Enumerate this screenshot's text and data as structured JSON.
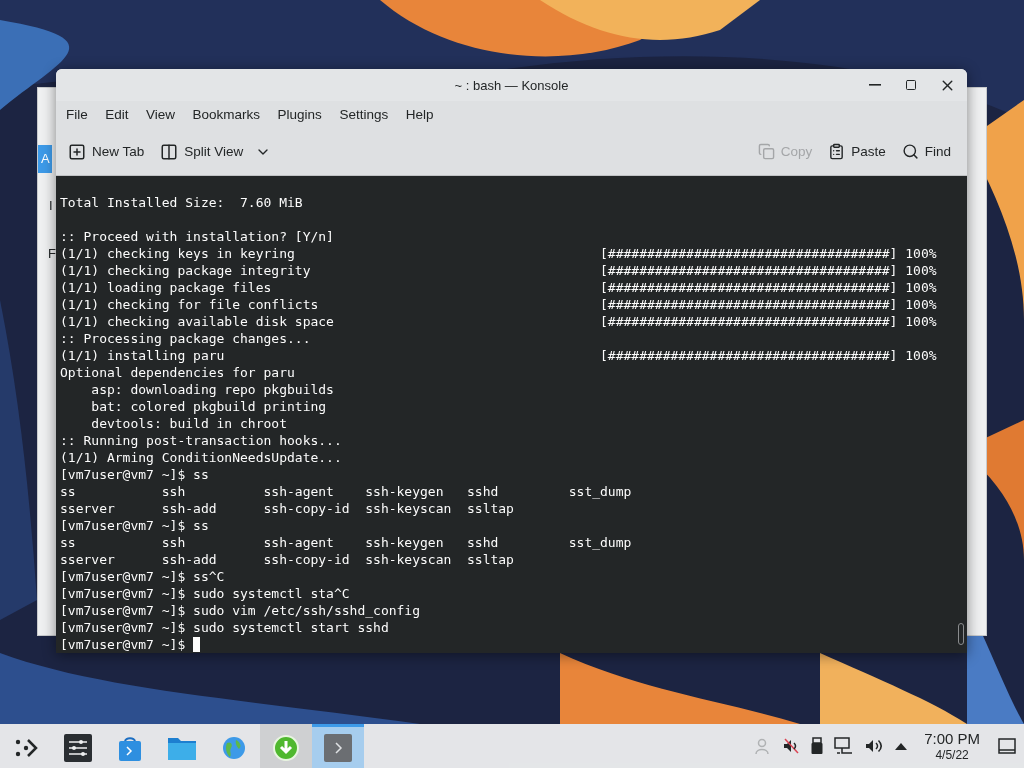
{
  "background_window": {
    "fragments": [
      "A",
      "I",
      "F"
    ]
  },
  "window": {
    "title": "~ : bash — Konsole"
  },
  "menu": [
    "File",
    "Edit",
    "View",
    "Bookmarks",
    "Plugins",
    "Settings",
    "Help"
  ],
  "toolbar": {
    "left": [
      {
        "label": "New Tab",
        "kind": "new-tab"
      },
      {
        "label": "Split View",
        "kind": "split-view"
      }
    ],
    "right": [
      {
        "label": "Copy",
        "kind": "copy",
        "disabled": true
      },
      {
        "label": "Paste",
        "kind": "paste",
        "disabled": false
      },
      {
        "label": "Find",
        "kind": "find",
        "disabled": false
      }
    ]
  },
  "terminal": {
    "lines": [
      {
        "kind": "text",
        "text": "Total Installed Size:  7.60 MiB"
      },
      {
        "kind": "blank"
      },
      {
        "kind": "text",
        "text": ":: Proceed with installation? [Y/n]"
      },
      {
        "kind": "progress",
        "text": "(1/1) checking keys in keyring",
        "bar": "[####################################] 100%"
      },
      {
        "kind": "progress",
        "text": "(1/1) checking package integrity",
        "bar": "[####################################] 100%"
      },
      {
        "kind": "progress",
        "text": "(1/1) loading package files",
        "bar": "[####################################] 100%"
      },
      {
        "kind": "progress",
        "text": "(1/1) checking for file conflicts",
        "bar": "[####################################] 100%"
      },
      {
        "kind": "progress",
        "text": "(1/1) checking available disk space",
        "bar": "[####################################] 100%"
      },
      {
        "kind": "text",
        "text": ":: Processing package changes..."
      },
      {
        "kind": "progress",
        "text": "(1/1) installing paru",
        "bar": "[####################################] 100%"
      },
      {
        "kind": "text",
        "text": "Optional dependencies for paru"
      },
      {
        "kind": "text",
        "text": "    asp: downloading repo pkgbuilds"
      },
      {
        "kind": "text",
        "text": "    bat: colored pkgbuild printing"
      },
      {
        "kind": "text",
        "text": "    devtools: build in chroot"
      },
      {
        "kind": "text",
        "text": ":: Running post-transaction hooks..."
      },
      {
        "kind": "text",
        "text": "(1/1) Arming ConditionNeedsUpdate..."
      },
      {
        "kind": "text",
        "text": "[vm7user@vm7 ~]$ ss"
      },
      {
        "kind": "text",
        "text": "ss           ssh          ssh-agent    ssh-keygen   sshd         sst_dump"
      },
      {
        "kind": "text",
        "text": "sserver      ssh-add      ssh-copy-id  ssh-keyscan  ssltap"
      },
      {
        "kind": "text",
        "text": "[vm7user@vm7 ~]$ ss"
      },
      {
        "kind": "text",
        "text": "ss           ssh          ssh-agent    ssh-keygen   sshd         sst_dump"
      },
      {
        "kind": "text",
        "text": "sserver      ssh-add      ssh-copy-id  ssh-keyscan  ssltap"
      },
      {
        "kind": "text",
        "text": "[vm7user@vm7 ~]$ ss^C"
      },
      {
        "kind": "text",
        "text": "[vm7user@vm7 ~]$ sudo systemctl sta^C"
      },
      {
        "kind": "text",
        "text": "[vm7user@vm7 ~]$ sudo vim /etc/ssh/sshd_config"
      },
      {
        "kind": "text",
        "text": "[vm7user@vm7 ~]$ sudo systemctl start sshd"
      },
      {
        "kind": "cursor",
        "text": "[vm7user@vm7 ~]$ "
      }
    ]
  },
  "taskbar": {
    "apps": [
      {
        "kind": "launcher",
        "selected": false,
        "highlighted": false
      },
      {
        "kind": "settings",
        "selected": false,
        "highlighted": false
      },
      {
        "kind": "store",
        "selected": false,
        "highlighted": false
      },
      {
        "kind": "folder",
        "selected": false,
        "highlighted": false
      },
      {
        "kind": "browser",
        "selected": false,
        "highlighted": false
      },
      {
        "kind": "download",
        "selected": false,
        "highlighted": true
      },
      {
        "kind": "terminal",
        "selected": true,
        "highlighted": false
      }
    ],
    "tray": [
      {
        "kind": "user",
        "disabled": true
      },
      {
        "kind": "mute",
        "disabled": false
      },
      {
        "kind": "usb",
        "disabled": false
      },
      {
        "kind": "network",
        "disabled": false
      },
      {
        "kind": "volume",
        "disabled": false
      },
      {
        "kind": "expand",
        "disabled": false
      }
    ],
    "clock": {
      "time": "7:00 PM",
      "date": "4/5/22"
    }
  }
}
